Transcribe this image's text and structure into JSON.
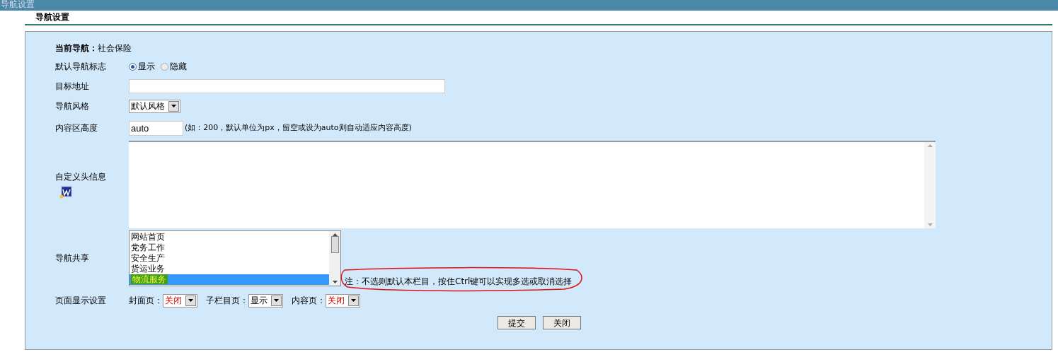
{
  "top_bar": {
    "title": "导航设置"
  },
  "section_title": "导航设置",
  "current_nav": {
    "label": "当前导航：",
    "value": "社会保险"
  },
  "default_flag": {
    "label": "默认导航标志",
    "options": [
      {
        "label": "显示",
        "selected": true
      },
      {
        "label": "隐藏",
        "selected": false
      }
    ]
  },
  "target_url": {
    "label": "目标地址"
  },
  "nav_style": {
    "label": "导航风格",
    "value": "默认风格"
  },
  "content_height": {
    "label": "内容区高度",
    "value": "auto",
    "hint": "(如：200，默认单位为px，留空或设为auto则自动适应内容高度)"
  },
  "custom_header": {
    "label": "自定义头信息"
  },
  "nav_share": {
    "label": "导航共享",
    "items": [
      {
        "label": "网站首页",
        "selected": false
      },
      {
        "label": "党务工作",
        "selected": false
      },
      {
        "label": "安全生产",
        "selected": false
      },
      {
        "label": "货运业务",
        "selected": false
      },
      {
        "label": "物流服务",
        "selected": true
      }
    ],
    "note": "注：不选则默认本栏目，按住Ctrl键可以实现多选或取消选择"
  },
  "page_display": {
    "label": "页面显示设置",
    "selects": [
      {
        "label": "封面页：",
        "value": "关闭",
        "highlighted": true
      },
      {
        "label": "子栏目页：",
        "value": "显示",
        "highlighted": false
      },
      {
        "label": "内容页：",
        "value": "关闭",
        "highlighted": true
      }
    ]
  },
  "buttons": [
    "提交",
    "关闭"
  ]
}
